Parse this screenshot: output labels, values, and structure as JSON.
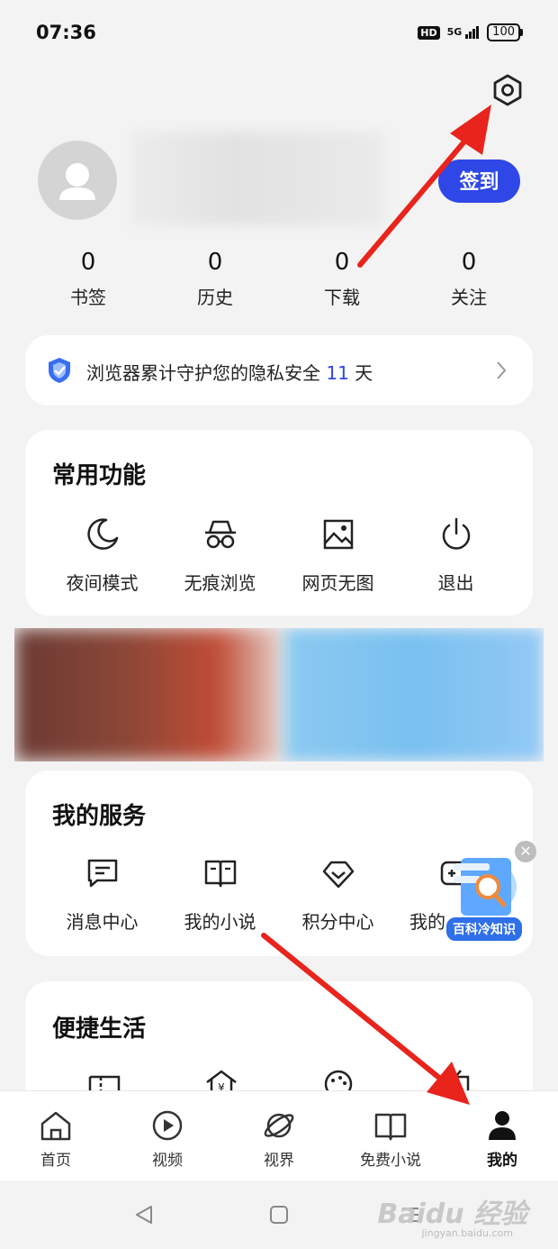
{
  "status_bar": {
    "time": "07:36",
    "hd": "HD",
    "network": "5G",
    "battery": "100"
  },
  "header": {
    "checkin_label": "签到"
  },
  "stats": [
    {
      "value": "0",
      "label": "书签"
    },
    {
      "value": "0",
      "label": "历史"
    },
    {
      "value": "0",
      "label": "下载"
    },
    {
      "value": "0",
      "label": "关注"
    }
  ],
  "privacy": {
    "prefix": "浏览器累计守护您的隐私安全 ",
    "days": "11",
    "suffix": " 天"
  },
  "common": {
    "title": "常用功能",
    "items": [
      {
        "label": "夜间模式",
        "icon": "moon-icon"
      },
      {
        "label": "无痕浏览",
        "icon": "incognito-icon"
      },
      {
        "label": "网页无图",
        "icon": "image-icon"
      },
      {
        "label": "退出",
        "icon": "power-icon"
      }
    ]
  },
  "services": {
    "title": "我的服务",
    "items": [
      {
        "label": "消息中心",
        "icon": "message-icon"
      },
      {
        "label": "我的小说",
        "icon": "book-icon"
      },
      {
        "label": "积分中心",
        "icon": "diamond-icon"
      },
      {
        "label": "我的",
        "icon": "game-icon"
      }
    ]
  },
  "life": {
    "title": "便捷生活"
  },
  "floating": {
    "label": "百科冷知识"
  },
  "bottom_nav": [
    {
      "label": "首页",
      "icon": "home-icon"
    },
    {
      "label": "视频",
      "icon": "play-icon"
    },
    {
      "label": "视界",
      "icon": "planet-icon"
    },
    {
      "label": "免费小说",
      "icon": "book-open-icon"
    },
    {
      "label": "我的",
      "icon": "person-icon",
      "active": true
    }
  ],
  "watermark": {
    "text": "Baidu 经验",
    "sub": "jingyan.baidu.com"
  },
  "colors": {
    "accent": "#2f47e6",
    "annotation_arrow": "#e8241c"
  }
}
